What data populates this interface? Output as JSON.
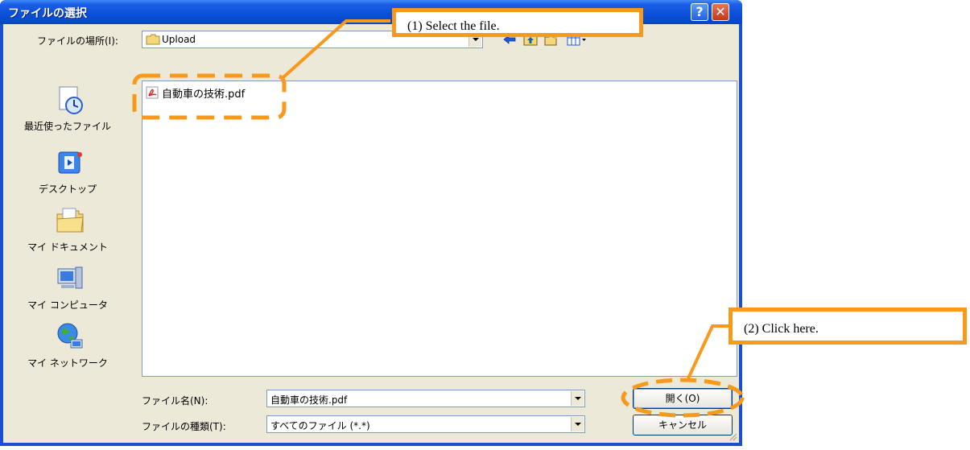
{
  "dialog": {
    "title": "ファイルの選択",
    "help_glyph": "?",
    "close_glyph": "✕"
  },
  "location": {
    "label": "ファイルの場所(I):",
    "value": "Upload"
  },
  "places": [
    {
      "label": "最近使ったファイル",
      "icon": "recent-documents-icon"
    },
    {
      "label": "デスクトップ",
      "icon": "desktop-icon"
    },
    {
      "label": "マイ ドキュメント",
      "icon": "my-documents-icon"
    },
    {
      "label": "マイ コンピュータ",
      "icon": "my-computer-icon"
    },
    {
      "label": "マイ ネットワーク",
      "icon": "my-network-icon"
    }
  ],
  "files": [
    {
      "name": "自動車の技術.pdf",
      "icon": "pdf-file-icon"
    }
  ],
  "filename": {
    "label": "ファイル名(N):",
    "value": "自動車の技術.pdf"
  },
  "filetype": {
    "label": "ファイルの種類(T):",
    "value": "すべてのファイル (*.*)"
  },
  "buttons": {
    "open": "開く(O)",
    "cancel": "キャンセル"
  },
  "annotations": {
    "step1": "(1) Select the file.",
    "step2": "(2) Click here."
  },
  "colors": {
    "highlight": "#f7991b",
    "titlebar": "#0a4fd8",
    "dialog_bg": "#ece9d8"
  }
}
